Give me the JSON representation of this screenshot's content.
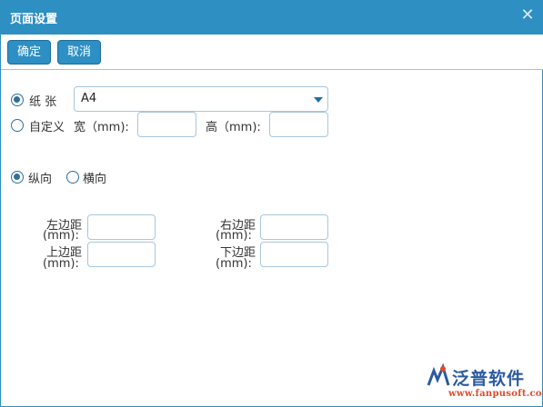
{
  "dialog": {
    "title": "页面设置"
  },
  "toolbar": {
    "ok_label": "确定",
    "cancel_label": "取消"
  },
  "paper": {
    "paper_label": "纸 张",
    "selected_size": "A4",
    "custom_label": "自定义",
    "width_label": "宽（mm):",
    "height_label": "高（mm):",
    "width_value": "",
    "height_value": ""
  },
  "orientation": {
    "portrait_label": "纵向",
    "landscape_label": "横向"
  },
  "margins": {
    "left_label_1": "左边距",
    "left_label_2": "(mm):",
    "right_label_1": "右边距",
    "right_label_2": "(mm):",
    "top_label_1": "上边距",
    "top_label_2": "(mm):",
    "bottom_label_1": "下边距",
    "bottom_label_2": "(mm):",
    "left_value": "",
    "right_value": "",
    "top_value": "",
    "bottom_value": ""
  },
  "watermark": {
    "brand": "泛普软件",
    "url": "www.fanpusoft.com"
  },
  "colors": {
    "titlebar": "#2e8fc3",
    "button": "#2d8fc3",
    "radio": "#2e6fa0",
    "brand_blue": "#2b5aa0",
    "brand_red": "#e04a2b"
  }
}
